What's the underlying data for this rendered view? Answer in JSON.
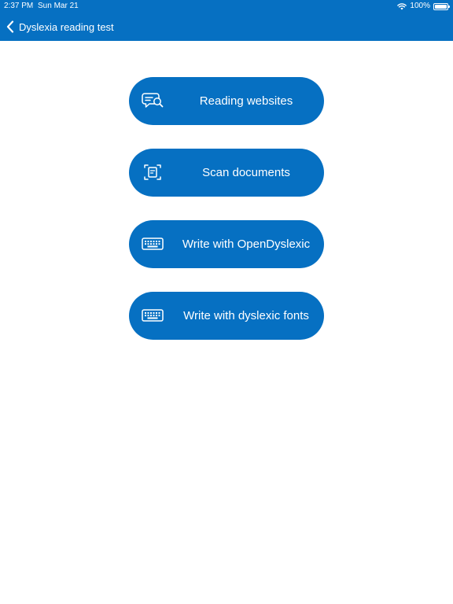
{
  "status_bar": {
    "time": "2:37 PM",
    "date": "Sun Mar 21",
    "battery": "100%",
    "battery_level": 1.0
  },
  "nav": {
    "back_icon": "chevron-left-icon",
    "title": "Dyslexia reading test"
  },
  "menu": {
    "items": [
      {
        "label": "Reading websites",
        "icon": "chat-search-icon"
      },
      {
        "label": "Scan documents",
        "icon": "document-scan-icon"
      },
      {
        "label": "Write with OpenDyslexic",
        "icon": "keyboard-icon"
      },
      {
        "label": "Write with dyslexic fonts",
        "icon": "keyboard-icon"
      }
    ]
  },
  "colors": {
    "accent": "#0670c2",
    "background": "#ffffff",
    "text_on_accent": "#ffffff"
  }
}
